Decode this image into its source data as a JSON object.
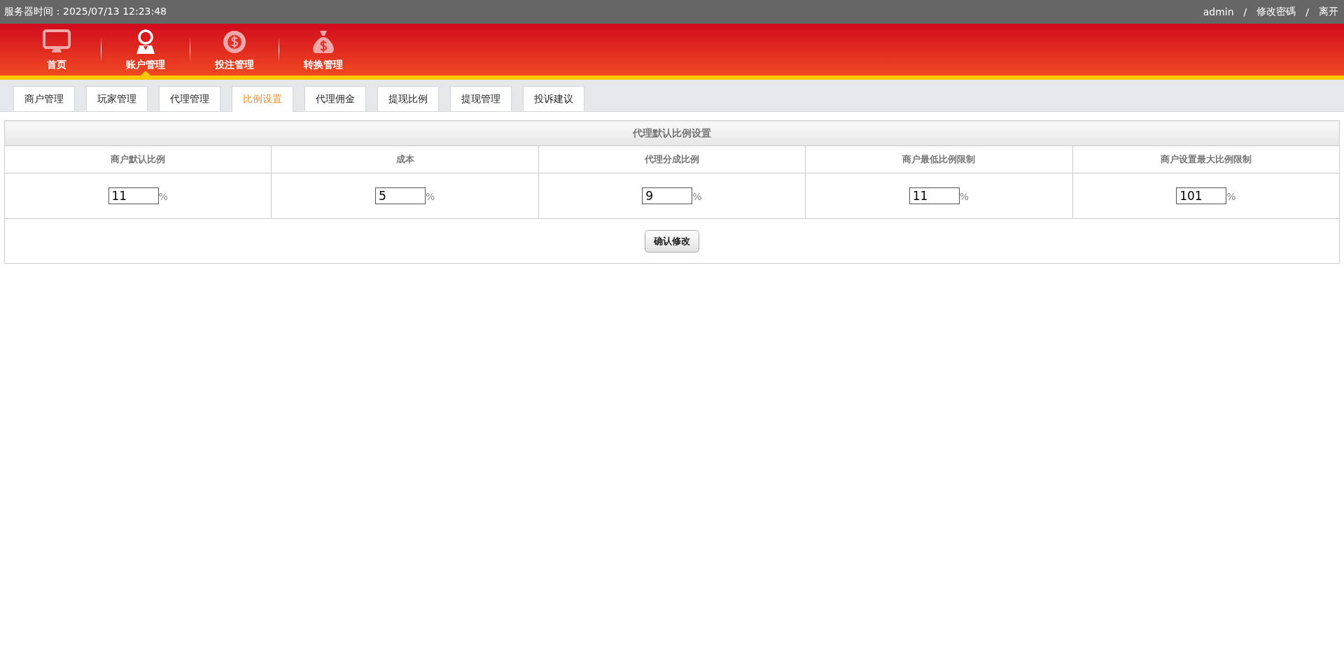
{
  "top_bar": {
    "server_time_label": "服务器时间：",
    "server_time": "2025/07/13 12:23:48",
    "user": "admin",
    "separator_1": "/",
    "change_password": "修改密碼",
    "separator_2": "/",
    "logout": "离开"
  },
  "nav": [
    {
      "label": "首页",
      "kind": "monitor",
      "selected": false
    },
    {
      "label": "账户管理",
      "kind": "person",
      "selected": true
    },
    {
      "label": "投注管理",
      "kind": "chip",
      "selected": false
    },
    {
      "label": "转换管理",
      "kind": "moneybag",
      "selected": false
    }
  ],
  "tabs": [
    {
      "label": "商户管理",
      "selected": false
    },
    {
      "label": "玩家管理",
      "selected": false
    },
    {
      "label": "代理管理",
      "selected": false
    },
    {
      "label": "比例设置",
      "selected": true
    },
    {
      "label": "代理佣金",
      "selected": false
    },
    {
      "label": "提现比例",
      "selected": false
    },
    {
      "label": "提现管理",
      "selected": false
    },
    {
      "label": "投诉建议",
      "selected": false
    }
  ],
  "settings_table": {
    "title": "代理默认比例设置",
    "columns": [
      {
        "header": "商户默认比例",
        "value": "11",
        "unit": "%"
      },
      {
        "header": "成本",
        "value": "5",
        "unit": "%"
      },
      {
        "header": "代理分成比例",
        "value": "9",
        "unit": "%"
      },
      {
        "header": "商户最低比例限制",
        "value": "11",
        "unit": "%"
      },
      {
        "header": "商户设置最大比例限制",
        "value": "101",
        "unit": "%"
      }
    ],
    "submit": "确认修改"
  }
}
